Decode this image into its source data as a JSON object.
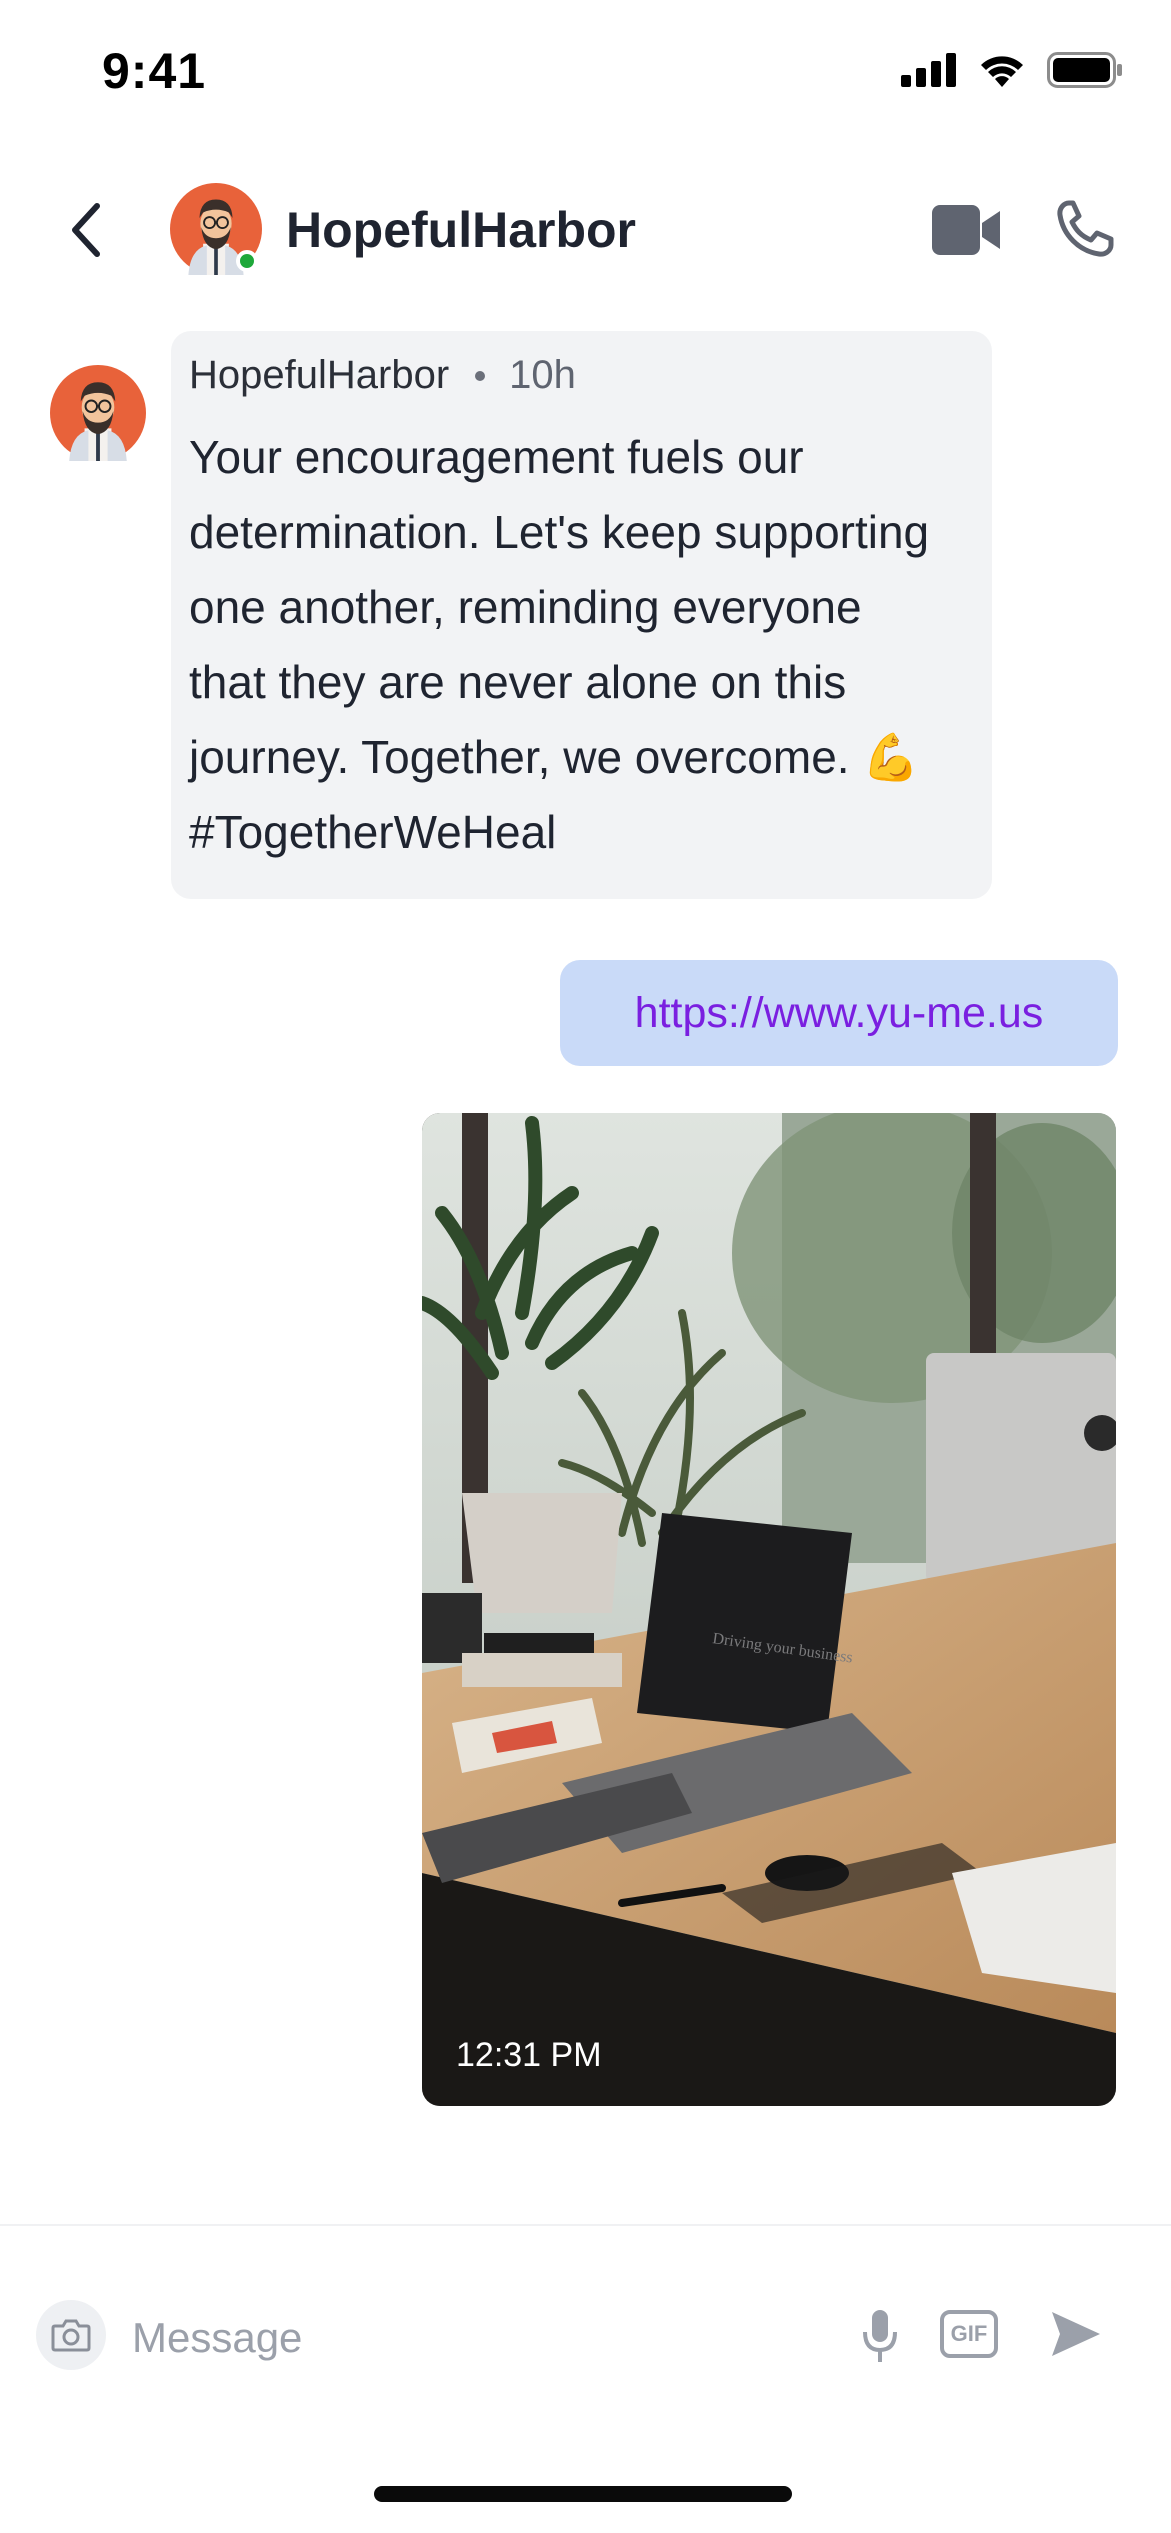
{
  "status_bar": {
    "time": "9:41"
  },
  "header": {
    "contact_name": "HopefulHarbor",
    "online": true
  },
  "messages": [
    {
      "type": "incoming",
      "sender": "HopefulHarbor",
      "ago": "10h",
      "text": "Your encouragement fuels our determination. Let's keep supporting one another, reminding everyone that they are never alone on this journey. Together, we overcome. 💪 #TogetherWeHeal"
    },
    {
      "type": "outgoing_link",
      "text": "https://www.yu-me.us"
    },
    {
      "type": "outgoing_image",
      "time": "12:31 PM",
      "image_text": "Driving your business"
    }
  ],
  "composer": {
    "placeholder": "Message",
    "gif_label": "GIF"
  },
  "colors": {
    "avatar_bg": "#e8623a",
    "online": "#1ea83a",
    "incoming_bubble": "#f2f3f5",
    "outgoing_bubble": "#c9daf8",
    "link": "#7a1fe0",
    "icon_gray": "#5f6470"
  },
  "icons": [
    "back-chevron-icon",
    "video-camera-icon",
    "phone-icon",
    "camera-icon",
    "microphone-icon",
    "gif-icon",
    "send-icon",
    "signal-icon",
    "wifi-icon",
    "battery-icon"
  ]
}
